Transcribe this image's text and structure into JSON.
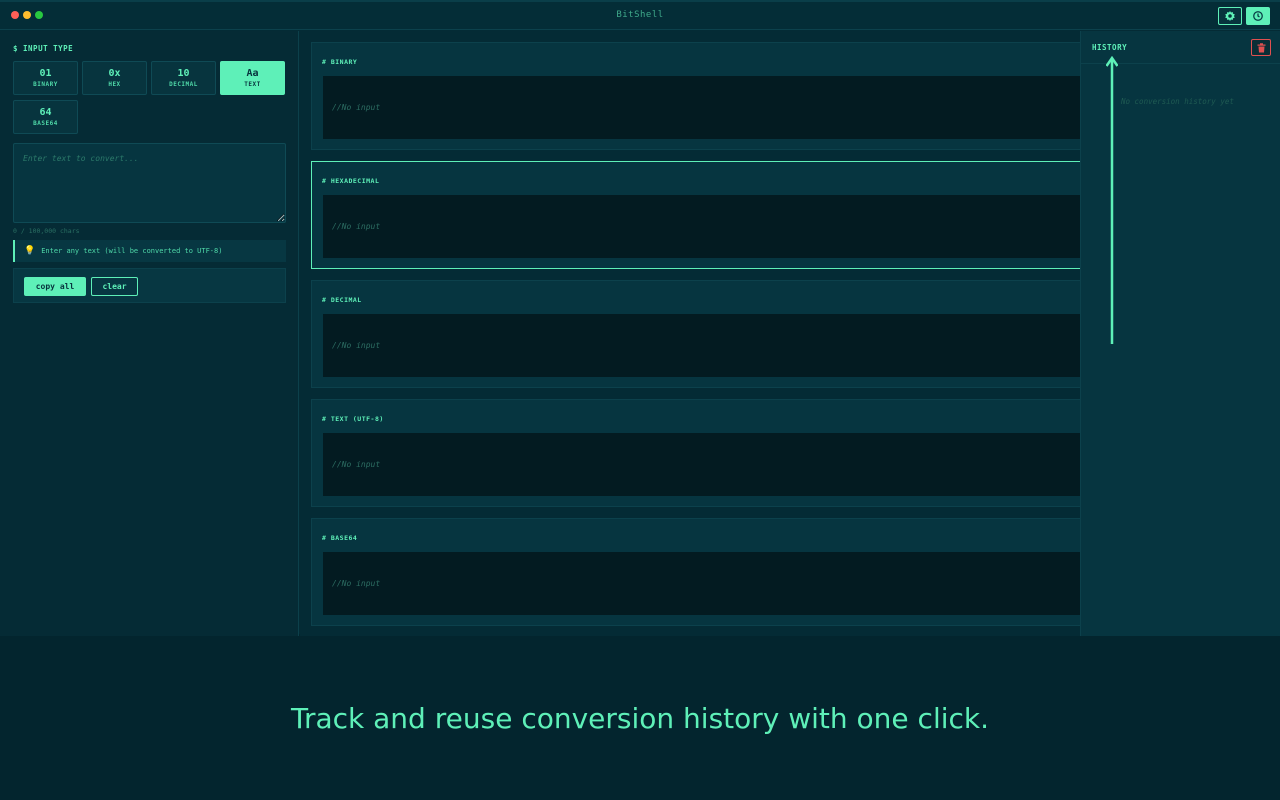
{
  "window": {
    "title": "BitShell",
    "settings_icon": "gear-icon",
    "history_icon": "clock-icon"
  },
  "sidebar": {
    "section_label": "$ INPUT TYPE",
    "types": [
      {
        "symbol": "01",
        "name": "BINARY",
        "active": false
      },
      {
        "symbol": "0x",
        "name": "HEX",
        "active": false
      },
      {
        "symbol": "10",
        "name": "DECIMAL",
        "active": false
      },
      {
        "symbol": "Aa",
        "name": "TEXT",
        "active": true
      },
      {
        "symbol": "64",
        "name": "BASE64",
        "active": false
      }
    ],
    "input_placeholder": "Enter text to convert...",
    "input_value": "",
    "char_count": "0 / 100,000 chars",
    "hint": "Enter any text (will be converted to UTF-8)",
    "copy_all_label": "copy all",
    "clear_label": "clear"
  },
  "outputs": [
    {
      "title": "# BINARY",
      "value": "//No input"
    },
    {
      "title": "# HEXADECIMAL",
      "value": "//No input"
    },
    {
      "title": "# DECIMAL",
      "value": "//No input"
    },
    {
      "title": "# TEXT (UTF-8)",
      "value": "//No input"
    },
    {
      "title": "# BASE64",
      "value": "//No input"
    }
  ],
  "history": {
    "title": "HISTORY",
    "empty_text": "No conversion history yet",
    "clear_icon": "trash-icon"
  },
  "caption": "Track and reuse conversion history with one click.",
  "colors": {
    "accent": "#5ef0b8",
    "background": "#03252e",
    "danger": "#e05050"
  }
}
